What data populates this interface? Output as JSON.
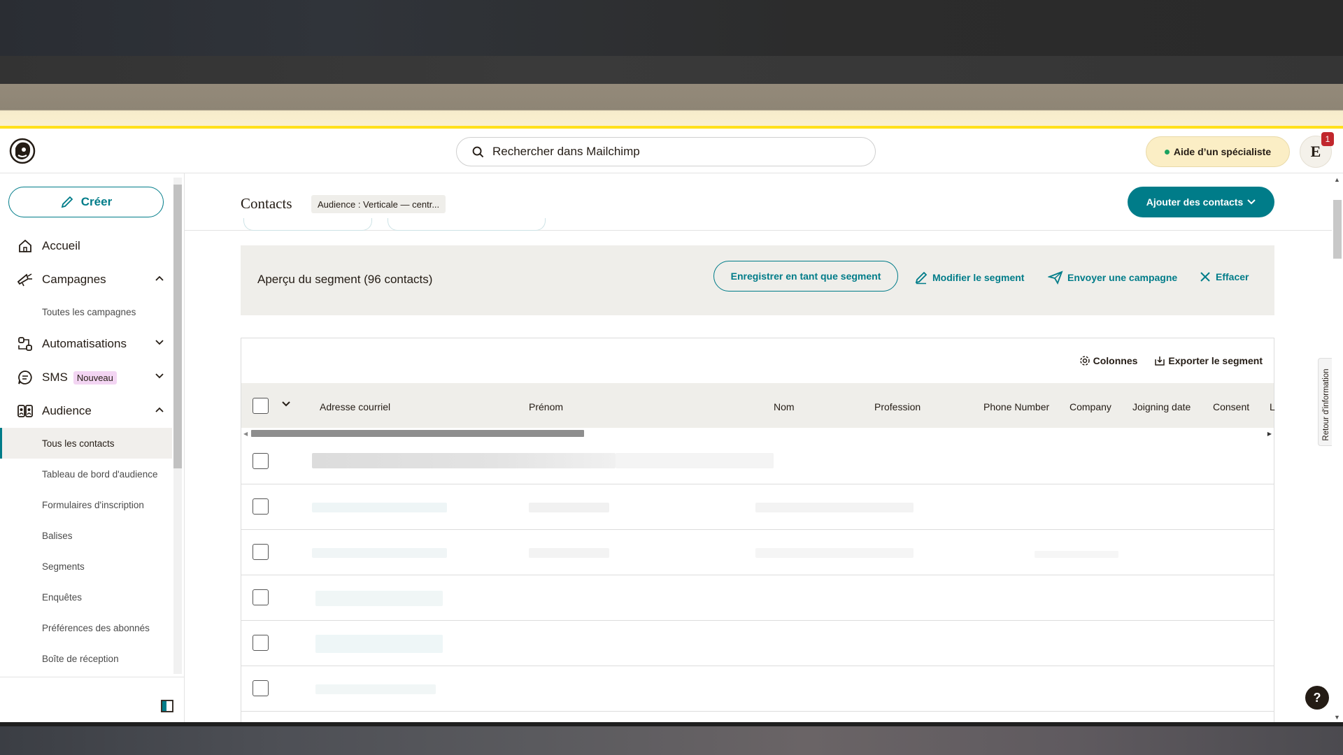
{
  "header": {
    "search_placeholder": "Rechercher dans Mailchimp",
    "help_label": "Aide d’un spécialiste",
    "avatar_initial": "E",
    "notification_count": "1"
  },
  "sidebar": {
    "create_label": "Créer",
    "items": [
      {
        "label": "Accueil",
        "icon": "home-icon"
      },
      {
        "label": "Campagnes",
        "icon": "megaphone-icon",
        "expanded": true
      },
      {
        "label": "Toutes les campagnes"
      },
      {
        "label": "Automatisations",
        "icon": "automation-icon",
        "expanded": false
      },
      {
        "label": "SMS",
        "icon": "sms-icon",
        "badge": "Nouveau",
        "expanded": false
      },
      {
        "label": "Audience",
        "icon": "audience-icon",
        "expanded": true
      }
    ],
    "audience_sub": [
      {
        "label": "Tous les contacts",
        "active": true
      },
      {
        "label": "Tableau de bord d'audience"
      },
      {
        "label": "Formulaires d'inscription"
      },
      {
        "label": "Balises"
      },
      {
        "label": "Segments"
      },
      {
        "label": "Enquêtes"
      },
      {
        "label": "Préférences des abonnés"
      },
      {
        "label": "Boîte de réception"
      }
    ]
  },
  "page": {
    "title": "Contacts",
    "audience_chip": "Audience : Verticale — centr...",
    "add_contacts_label": "Ajouter des contacts"
  },
  "segment": {
    "title": "Aperçu du segment (96 contacts)",
    "save_label": "Enregistrer en tant que segment",
    "edit_label": "Modifier le segment",
    "send_label": "Envoyer une campagne",
    "clear_label": "Effacer"
  },
  "table": {
    "columns_label": "Colonnes",
    "export_label": "Exporter le segment",
    "headers": [
      "Adresse courriel",
      "Prénom",
      "Nom",
      "Profession",
      "Phone Number",
      "Company",
      "Joigning date",
      "Consent",
      "L"
    ],
    "row_count_visible": 6
  },
  "feedback_label": "Retour d'information",
  "help_fab": "?",
  "colors": {
    "accent": "#007c89",
    "panel": "#efeeea",
    "warning_bar": "#ffe01b"
  }
}
